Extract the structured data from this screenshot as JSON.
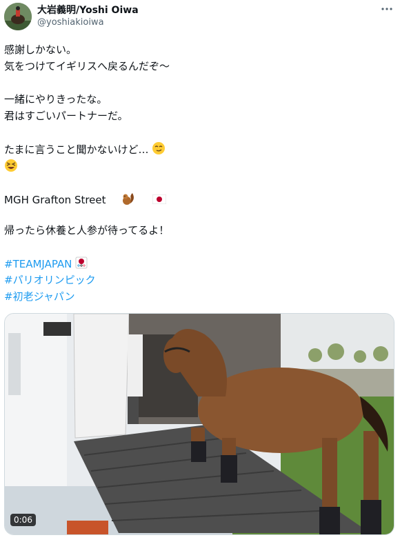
{
  "author": {
    "display_name": "大岩義明/Yoshi Oiwa",
    "handle": "@yoshiakioiwa"
  },
  "tweet": {
    "lines": [
      "感謝しかない。",
      "気をつけてイギリスへ戻るんだぞ〜",
      "一緒にやりきったな。",
      "君はすごいパートナーだ。",
      "たまに言うこと聞かないけど…",
      "MGH Grafton Street",
      "帰ったら休養と人参が待ってるよ！"
    ],
    "hashtags": [
      "#TEAMJAPAN",
      "#パリオリンピック",
      "#初老ジャパン"
    ]
  },
  "icons": {
    "more": "more-horizontal-icon",
    "smirk": "smirking-face-emoji",
    "laugh": "grinning-squinting-face-emoji",
    "chipmunk": "chipmunk-emoji",
    "flag": "japan-flag-emoji",
    "olympic": "japan-olympic-team-emoji"
  },
  "media": {
    "type": "video",
    "duration": "0:06"
  },
  "colors": {
    "link": "#1d9bf0",
    "text": "#0f1419",
    "secondary": "#536471"
  }
}
